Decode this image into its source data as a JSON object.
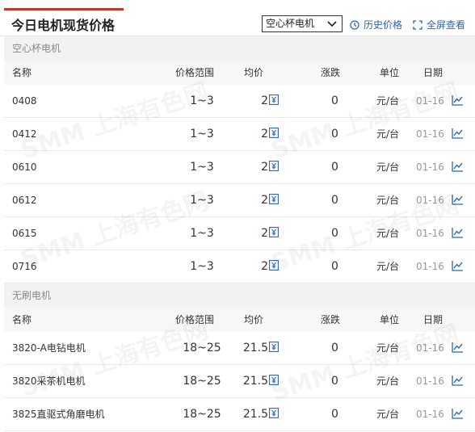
{
  "header": {
    "title": "今日电机现货价格",
    "select_value": "空心杯电机",
    "history_label": "历史价格",
    "fullscreen_label": "全屏查看"
  },
  "columns": {
    "name": "名称",
    "range": "价格范围",
    "avg": "均价",
    "change": "涨跌",
    "unit": "单位",
    "date": "日期"
  },
  "sections": [
    {
      "title": "空心杯电机",
      "rows": [
        {
          "name": "0408",
          "range": "1~3",
          "avg": "2",
          "change": "0",
          "unit": "元/台",
          "date": "01-16"
        },
        {
          "name": "0412",
          "range": "1~3",
          "avg": "2",
          "change": "0",
          "unit": "元/台",
          "date": "01-16"
        },
        {
          "name": "0610",
          "range": "1~3",
          "avg": "2",
          "change": "0",
          "unit": "元/台",
          "date": "01-16"
        },
        {
          "name": "0612",
          "range": "1~3",
          "avg": "2",
          "change": "0",
          "unit": "元/台",
          "date": "01-16"
        },
        {
          "name": "0615",
          "range": "1~3",
          "avg": "2",
          "change": "0",
          "unit": "元/台",
          "date": "01-16"
        },
        {
          "name": "0716",
          "range": "1~3",
          "avg": "2",
          "change": "0",
          "unit": "元/台",
          "date": "01-16"
        }
      ]
    },
    {
      "title": "无刷电机",
      "rows": [
        {
          "name": "3820-A电钻电机",
          "range": "18~25",
          "avg": "21.5",
          "change": "0",
          "unit": "元/台",
          "date": "01-16"
        },
        {
          "name": "3820采茶机电机",
          "range": "18~25",
          "avg": "21.5",
          "change": "0",
          "unit": "元/台",
          "date": "01-16"
        },
        {
          "name": "3825直驱式角磨电机",
          "range": "18~25",
          "avg": "21.5",
          "change": "0",
          "unit": "元/台",
          "date": "01-16"
        }
      ]
    }
  ],
  "watermark_text": "SMM 上海有色网",
  "colors": {
    "accent": "#c0392b",
    "link": "#2c63b5"
  }
}
